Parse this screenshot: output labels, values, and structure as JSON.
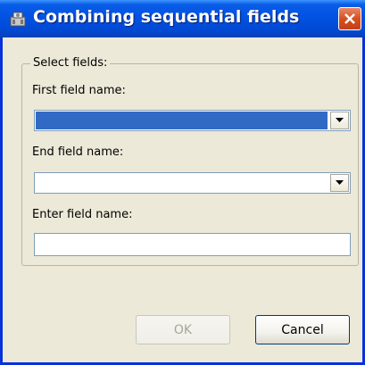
{
  "window": {
    "title": "Combining sequential fields",
    "title_icon": "tool-icon",
    "close_icon": "close-icon"
  },
  "group": {
    "legend": "Select fields:"
  },
  "fields": {
    "first_label": "First field name:",
    "first_value": "",
    "end_label": "End field name:",
    "end_value": "",
    "enter_label": "Enter field name:",
    "enter_value": ""
  },
  "buttons": {
    "ok": "OK",
    "cancel": "Cancel"
  },
  "colors": {
    "title_bar": "#0353e4",
    "dialog_bg": "#ece9d8",
    "selection": "#316ac5",
    "close": "#d6501f"
  }
}
